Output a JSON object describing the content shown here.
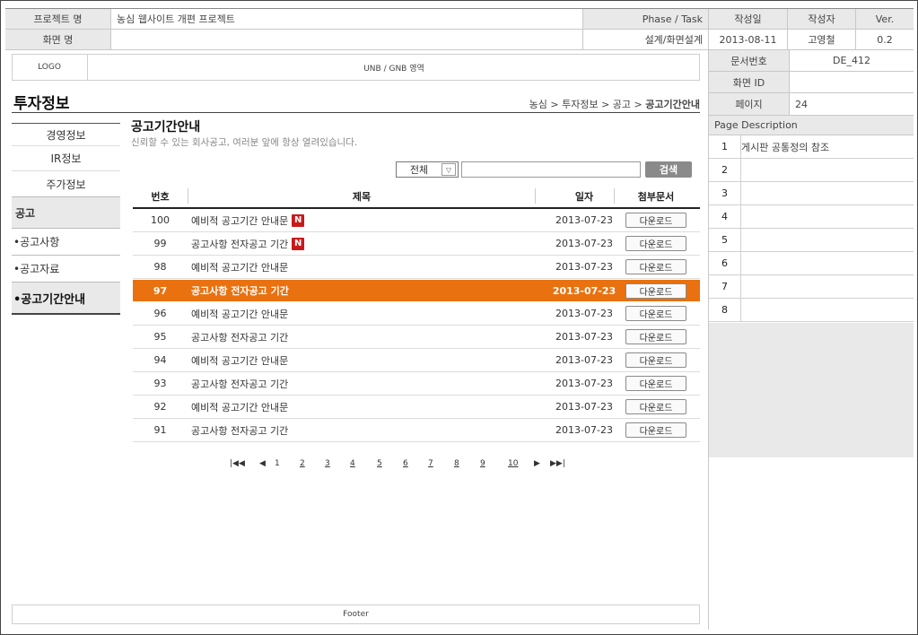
{
  "header": {
    "project_label": "프로젝트 명",
    "project_value": "농심 웹사이트 개편 프로젝트",
    "screen_label": "화면 명",
    "screen_value": "",
    "phase_label": "Phase / Task",
    "phase_value": "설계/화면설계",
    "date_label": "작성일",
    "date_value": "2013-08-11",
    "author_label": "작성자",
    "author_value": "고영철",
    "ver_label": "Ver.",
    "ver_value": "0.2"
  },
  "meta": {
    "doc_no_label": "문서번호",
    "doc_no_value": "DE_412",
    "screen_id_label": "화면 ID",
    "screen_id_value": "",
    "page_label": "페이지",
    "page_value": "24"
  },
  "description": {
    "title": "Page Description",
    "items": [
      {
        "num": "1",
        "text": "게시판 공통정의 참조"
      },
      {
        "num": "2",
        "text": ""
      },
      {
        "num": "3",
        "text": ""
      },
      {
        "num": "4",
        "text": ""
      },
      {
        "num": "5",
        "text": ""
      },
      {
        "num": "6",
        "text": ""
      },
      {
        "num": "7",
        "text": ""
      },
      {
        "num": "8",
        "text": ""
      }
    ]
  },
  "top": {
    "logo": "LOGO",
    "gnb": "UNB / GNB 영역"
  },
  "section": {
    "title": "투자정보",
    "breadcrumb_prefix": "농심 > 투자정보 > 공고 > ",
    "breadcrumb_current": "공고기간안내"
  },
  "nav": {
    "items": [
      "경영정보",
      "IR정보",
      "주가정보"
    ],
    "group": "공고",
    "sub_items": [
      "•공고사항",
      "•공고자료",
      "•공고기간안내"
    ]
  },
  "content": {
    "title": "공고기간안내",
    "subtitle": "신뢰할 수 있는 회사공고, 여러분 앞에 항상 열려있습니다."
  },
  "search": {
    "select_value": "전체",
    "input_value": "",
    "button": "검색"
  },
  "table": {
    "headers": [
      "번호",
      "제목",
      "일자",
      "첨부문서"
    ],
    "download_label": "다운로드",
    "new_badge": "N",
    "rows": [
      {
        "num": "100",
        "title": "예비적 공고기간 안내문",
        "date": "2013-07-23"
      },
      {
        "num": "99",
        "title": "공고사항 전자공고 기간",
        "date": "2013-07-23"
      },
      {
        "num": "98",
        "title": "예비적 공고기간 안내문",
        "date": "2013-07-23"
      },
      {
        "num": "97",
        "title": "공고사항 전자공고 기간",
        "date": "2013-07-23"
      },
      {
        "num": "96",
        "title": "예비적 공고기간 안내문",
        "date": "2013-07-23"
      },
      {
        "num": "95",
        "title": "공고사항 전자공고 기간",
        "date": "2013-07-23"
      },
      {
        "num": "94",
        "title": "예비적 공고기간 안내문",
        "date": "2013-07-23"
      },
      {
        "num": "93",
        "title": "공고사항 전자공고 기간",
        "date": "2013-07-23"
      },
      {
        "num": "92",
        "title": "예비적 공고기간 안내문",
        "date": "2013-07-23"
      },
      {
        "num": "91",
        "title": "공고사항 전자공고 기간",
        "date": "2013-07-23"
      }
    ]
  },
  "pagination": {
    "first": "|◀◀",
    "prev": "◀",
    "pages": [
      "1",
      "2",
      "3",
      "4",
      "5",
      "6",
      "7",
      "8",
      "9",
      "10"
    ],
    "next": "▶",
    "last": "▶▶|"
  },
  "footer": "Footer",
  "colors": {
    "highlight": "#e9710f",
    "new_badge": "#c81a1a"
  }
}
